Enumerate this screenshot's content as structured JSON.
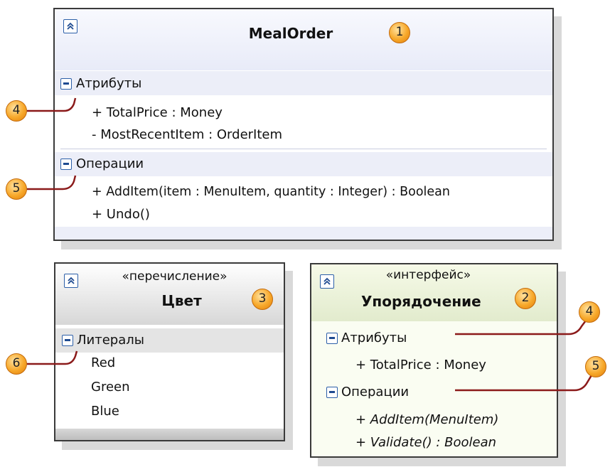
{
  "classes": {
    "mealorder": {
      "name": "MealOrder",
      "callout": "1",
      "attributes_label": "Атрибуты",
      "attributes": [
        "+ TotalPrice : Money",
        "- MostRecentItem : OrderItem"
      ],
      "operations_label": "Операции",
      "operations": [
        "+ AddItem(item : MenuItem, quantity : Integer) : Boolean",
        "+ Undo()"
      ]
    },
    "color_enum": {
      "stereotype": "«перечисление»",
      "name": "Цвет",
      "callout": "3",
      "literals_label": "Литералы",
      "literals": [
        "Red",
        "Green",
        "Blue"
      ]
    },
    "ordering_interface": {
      "stereotype": "«интерфейс»",
      "name": "Упорядочение",
      "callout": "2",
      "attributes_label": "Атрибуты",
      "attributes": [
        "+ TotalPrice : Money"
      ],
      "operations_label": "Операции",
      "operations": [
        "+ AddItem(MenuItem)",
        "+ Validate() : Boolean"
      ]
    }
  },
  "callouts": {
    "left_attributes": "4",
    "left_operations": "5",
    "left_literals": "6",
    "right_attributes": "4",
    "right_operations": "5"
  },
  "colors": {
    "section_band": "#eceef8",
    "enum_band": "#e4e4e4",
    "interface_bg": "#fafdf2",
    "leader_line": "#8b1a1a",
    "callout_orange": "#f7a82a"
  }
}
